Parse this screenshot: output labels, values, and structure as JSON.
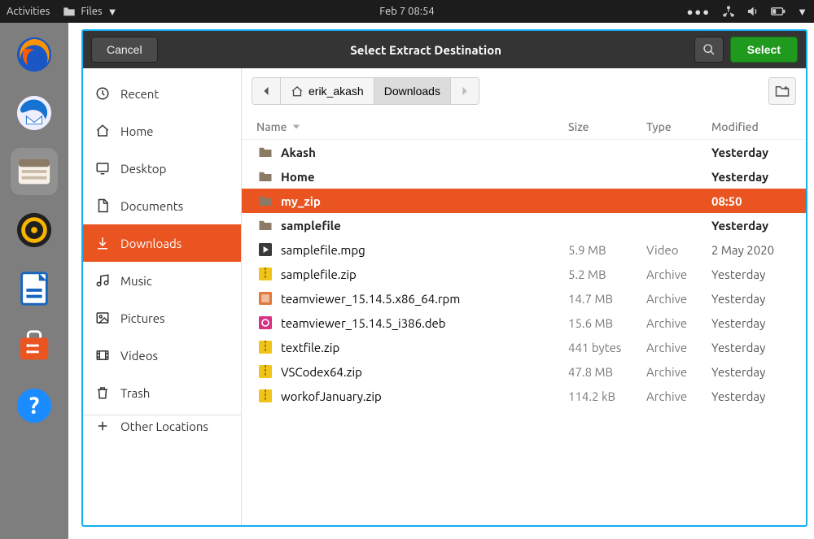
{
  "topbar": {
    "activities": "Activities",
    "files_label": "Files",
    "clock": "Feb 7  08:54"
  },
  "dialog": {
    "cancel": "Cancel",
    "title": "Select Extract Destination",
    "select": "Select"
  },
  "dock": [
    {
      "name": "firefox"
    },
    {
      "name": "thunderbird"
    },
    {
      "name": "files"
    },
    {
      "name": "rhythmbox"
    },
    {
      "name": "libreoffice"
    },
    {
      "name": "software"
    },
    {
      "name": "help"
    }
  ],
  "places": [
    {
      "icon": "recent",
      "label": "Recent"
    },
    {
      "icon": "home",
      "label": "Home"
    },
    {
      "icon": "desktop",
      "label": "Desktop"
    },
    {
      "icon": "documents",
      "label": "Documents"
    },
    {
      "icon": "downloads",
      "label": "Downloads",
      "active": true
    },
    {
      "icon": "music",
      "label": "Music"
    },
    {
      "icon": "pictures",
      "label": "Pictures"
    },
    {
      "icon": "videos",
      "label": "Videos"
    },
    {
      "icon": "trash",
      "label": "Trash"
    },
    {
      "icon": "other",
      "label": "Other Locations",
      "divider": true
    }
  ],
  "path": {
    "home_user": "erik_akash",
    "segments": [
      "Downloads"
    ]
  },
  "columns": {
    "name": "Name",
    "size": "Size",
    "type": "Type",
    "modified": "Modified"
  },
  "files": [
    {
      "icon": "folder",
      "name": "Akash",
      "size": "",
      "type": "",
      "modified": "Yesterday",
      "bold": true
    },
    {
      "icon": "folder",
      "name": "Home",
      "size": "",
      "type": "",
      "modified": "Yesterday",
      "bold": true
    },
    {
      "icon": "folder",
      "name": "my_zip",
      "size": "",
      "type": "",
      "modified": "08:50",
      "bold": true,
      "selected": true
    },
    {
      "icon": "folder",
      "name": "samplefile",
      "size": "",
      "type": "",
      "modified": "Yesterday",
      "bold": true
    },
    {
      "icon": "video",
      "name": "samplefile.mpg",
      "size": "5.9 MB",
      "type": "Video",
      "modified": "2 May 2020"
    },
    {
      "icon": "zip",
      "name": "samplefile.zip",
      "size": "5.2 MB",
      "type": "Archive",
      "modified": "Yesterday"
    },
    {
      "icon": "rpm",
      "name": "teamviewer_15.14.5.x86_64.rpm",
      "size": "14.7 MB",
      "type": "Archive",
      "modified": "Yesterday"
    },
    {
      "icon": "deb",
      "name": "teamviewer_15.14.5_i386.deb",
      "size": "15.6 MB",
      "type": "Archive",
      "modified": "Yesterday"
    },
    {
      "icon": "zip",
      "name": "textfile.zip",
      "size": "441 bytes",
      "type": "Archive",
      "modified": "Yesterday"
    },
    {
      "icon": "zip",
      "name": "VSCodex64.zip",
      "size": "47.8 MB",
      "type": "Archive",
      "modified": "Yesterday"
    },
    {
      "icon": "zip",
      "name": "workofJanuary.zip",
      "size": "114.2 kB",
      "type": "Archive",
      "modified": "Yesterday"
    }
  ]
}
